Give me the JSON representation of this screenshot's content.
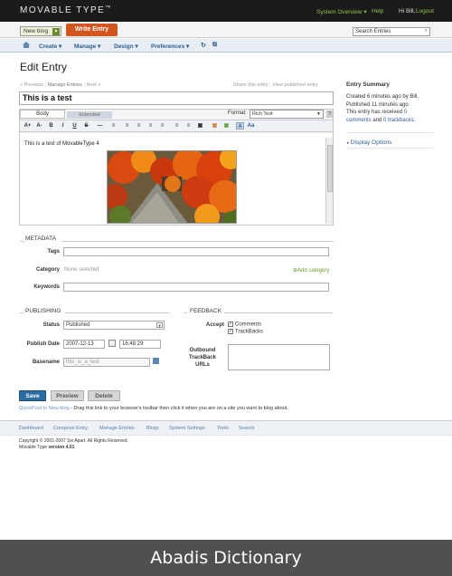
{
  "header": {
    "logo": "MOVABLE TYPE",
    "logo_tm": "™",
    "system_overview": "System Overview ▾",
    "help": "Help",
    "greeting": "Hi Bill,",
    "logout": "Logout"
  },
  "blogbar": {
    "blog_name": "New blog",
    "write_entry": "Write Entry",
    "search_placeholder": "Search Entries"
  },
  "nav": {
    "create": "Create ▾",
    "manage": "Manage ▾",
    "design": "Design ▾",
    "preferences": "Preferences ▾"
  },
  "page": {
    "title": "Edit Entry",
    "previous": "« Previous",
    "manage_entries": "Manage Entries",
    "next": "Next »",
    "share": "Share this entry",
    "view_published": "View published entry"
  },
  "editor": {
    "entry_title": "This is a test",
    "tab_body": "Body",
    "tab_extended": "Extended",
    "format_label": "Format:",
    "format_value": "Rich Text",
    "body_text": "This is a test of MovableType 4",
    "toolbar": [
      "A+",
      "A-",
      "B",
      "I",
      "U",
      "S",
      "―",
      "≡",
      "≡",
      "≡",
      "≡",
      "≡",
      "≡",
      "≡",
      "▣",
      "▣",
      "▣",
      "A",
      "Aa"
    ]
  },
  "metadata": {
    "heading": "METADATA",
    "tags_label": "Tags",
    "category_label": "Category",
    "category_value": "None selected",
    "add_category": "Add category",
    "keywords_label": "Keywords"
  },
  "publishing": {
    "heading": "PUBLISHING",
    "status_label": "Status",
    "status_value": "Published",
    "date_label": "Publish Date",
    "date_value": "2007-12-13",
    "time_value": "16:48:29",
    "basename_label": "Basename",
    "basename_value": "this_is_a_test"
  },
  "feedback": {
    "heading": "FEEDBACK",
    "accept_label": "Accept",
    "comments": "Comments",
    "trackbacks": "TrackBacks",
    "outbound_label_1": "Outbound",
    "outbound_label_2": "TrackBack",
    "outbound_label_3": "URLs"
  },
  "actions": {
    "save": "Save",
    "preview": "Preview",
    "delete": "Delete",
    "quickpost_link": "QuickPost to New blog",
    "quickpost_text": " - Drag this link to your browser's toolbar then click it when you are on a site you want to blog about."
  },
  "summary": {
    "heading": "Entry Summary",
    "created": "Created 6 minutes ago by Bill.",
    "published": "Published 11 minutes ago.",
    "received_prefix": "This entry has received ",
    "comments_link": "0 comments",
    "and": " and ",
    "trackbacks_link": "0 trackbacks",
    "display_options": "Display Options"
  },
  "footer": {
    "links": [
      "Dashboard",
      "Compose Entry",
      "Manage Entries",
      "Blogs",
      "System Settings",
      "Tools",
      "Search"
    ],
    "copyright": "Copyright © 2001-2007 Six Apart. All Rights Reserved.",
    "version_prefix": "Movable Type ",
    "version": "version 4.01"
  },
  "caption": "Abadis Dictionary",
  "colors": {
    "topbar": "#1b1b1b",
    "accent_orange": "#d2551d",
    "link_blue": "#2c5e94",
    "link_green": "#6b9a2b",
    "save_button": "#2b6ca3"
  }
}
